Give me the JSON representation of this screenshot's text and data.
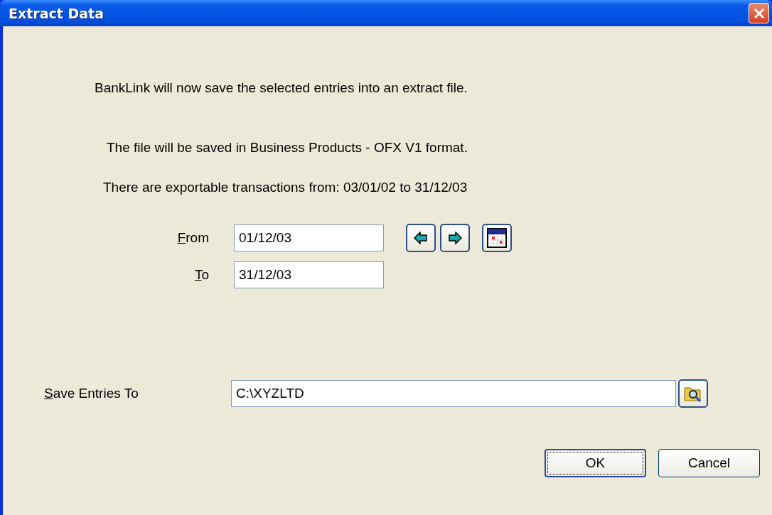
{
  "window": {
    "title": "Extract Data"
  },
  "messages": [
    "BankLink will now save the selected entries into an extract file.",
    "The file will be saved in Business Products - OFX V1 format.",
    "There are exportable transactions from: 03/01/02 to 31/12/03"
  ],
  "date_range": {
    "from": {
      "label": "From",
      "value": "01/12/03"
    },
    "to": {
      "label": "To",
      "value": "31/12/03"
    }
  },
  "save_to": {
    "label": "Save Entries To",
    "value": "C:\\XYZLTD"
  },
  "buttons": [
    {
      "label": "OK",
      "default": true
    },
    {
      "label": "Cancel",
      "default": false
    }
  ]
}
